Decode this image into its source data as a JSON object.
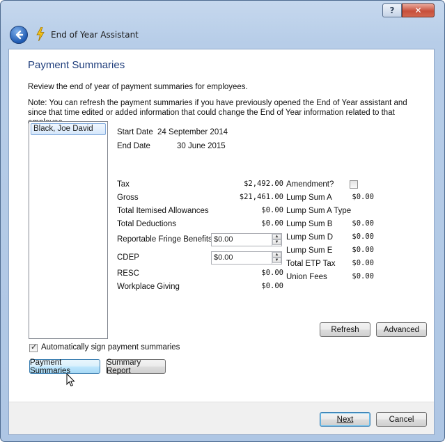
{
  "window": {
    "title": "End of Year Assistant",
    "help_label": "?",
    "close_label": "✕"
  },
  "page": {
    "heading": "Payment Summaries",
    "intro": "Review the end of year of payment summaries for employees.",
    "note": "Note: You can refresh the payment summaries if you have previously opened the End of Year assistant and since that time edited or added information that could change the End of Year information related to that employee."
  },
  "employees": [
    "Black, Joe David"
  ],
  "details": {
    "start_date_label": "Start Date",
    "start_date": "24 September 2014",
    "end_date_label": "End Date",
    "end_date": "30 June 2015"
  },
  "left_fields": [
    {
      "label": "Tax",
      "value": "$2,492.00"
    },
    {
      "label": "Gross",
      "value": "$21,461.00"
    },
    {
      "label": "Total Itemised Allowances",
      "value": "$0.00"
    },
    {
      "label": "Total Deductions",
      "value": "$0.00"
    },
    {
      "label": "Reportable Fringe Benefits",
      "input": "$0.00"
    },
    {
      "label": "CDEP",
      "input": "$0.00"
    },
    {
      "label": "RESC",
      "value": "$0.00"
    },
    {
      "label": "Workplace Giving",
      "value": "$0.00"
    }
  ],
  "right_fields": [
    {
      "label": "Amendment?",
      "checked": false
    },
    {
      "label": "Lump Sum A",
      "value": "$0.00"
    },
    {
      "label": "Lump Sum A Type",
      "value": ""
    },
    {
      "label": "Lump Sum B",
      "value": "$0.00"
    },
    {
      "label": "Lump Sum D",
      "value": "$0.00"
    },
    {
      "label": "Lump Sum E",
      "value": "$0.00"
    },
    {
      "label": "Total ETP Tax",
      "value": "$0.00"
    },
    {
      "label": "Union Fees",
      "value": "$0.00"
    }
  ],
  "buttons": {
    "refresh": "Refresh",
    "advanced": "Advanced",
    "payment_summaries": "Payment Summaries",
    "summary_report": "Summary Report",
    "next": "Next",
    "cancel": "Cancel"
  },
  "auto_sign": {
    "label": "Automatically sign payment summaries",
    "checked": true
  },
  "colors": {
    "heading": "#1e3d7b",
    "titlebar": "#b7cde8",
    "selection": "#d5e7fb"
  }
}
